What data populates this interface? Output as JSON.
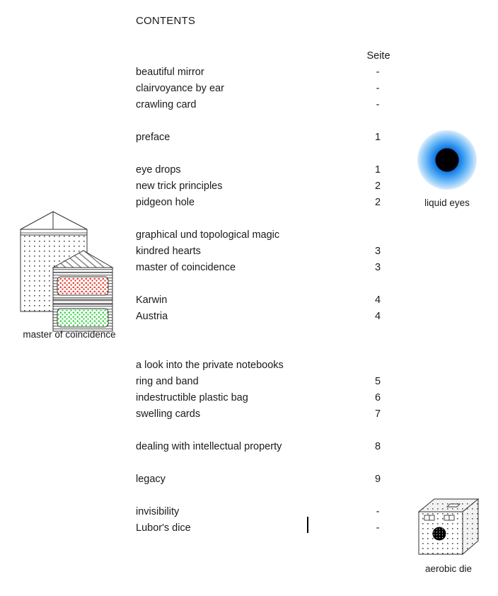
{
  "document": {
    "heading": "CONTENTS",
    "page_column_header": "Seite"
  },
  "toc": {
    "rows": [
      {
        "title": "beautiful mirror",
        "page": "-"
      },
      {
        "title": "clairvoyance by ear",
        "page": "-"
      },
      {
        "title": "crawling card",
        "page": "-"
      },
      {
        "title": "",
        "page": ""
      },
      {
        "title": "preface",
        "page": "1"
      },
      {
        "title": "",
        "page": ""
      },
      {
        "title": "eye drops",
        "page": "1"
      },
      {
        "title": "new trick principles",
        "page": "2"
      },
      {
        "title": "pidgeon hole",
        "page": "2"
      },
      {
        "title": "",
        "page": ""
      },
      {
        "title": "graphical und topological magic",
        "page": ""
      },
      {
        "title": "kindred hearts",
        "page": "3"
      },
      {
        "title": "master of coincidence",
        "page": "3"
      },
      {
        "title": "",
        "page": ""
      },
      {
        "title": "Karwin",
        "page": "4"
      },
      {
        "title": "Austria",
        "page": "4"
      },
      {
        "title": "",
        "page": ""
      },
      {
        "title": "",
        "page": ""
      },
      {
        "title": "a look into the private notebooks",
        "page": ""
      },
      {
        "title": "ring and band",
        "page": "5"
      },
      {
        "title": "indestructible plastic bag",
        "page": "6"
      },
      {
        "title": "swelling cards",
        "page": "7"
      },
      {
        "title": "",
        "page": ""
      },
      {
        "title": "dealing with intellectual property",
        "page": "8"
      },
      {
        "title": "",
        "page": ""
      },
      {
        "title": "legacy",
        "page": "9"
      },
      {
        "title": "",
        "page": ""
      },
      {
        "title": "invisibility",
        "page": "-"
      },
      {
        "title": "Lubor's dice",
        "page": "-"
      }
    ]
  },
  "figures": {
    "master_of_coincidence": {
      "caption": "master of coincidence",
      "colors": {
        "red_fill": "#e03020",
        "green_fill": "#22cc33",
        "outline": "#333333"
      }
    },
    "liquid_eyes": {
      "caption": "liquid eyes",
      "colors": {
        "pupil": "#000000",
        "iris": "#1478e0"
      }
    },
    "aerobic_die": {
      "caption": "aerobic die",
      "colors": {
        "outline": "#333333",
        "pip": "#000000"
      }
    }
  },
  "caret": {
    "visible": "true"
  }
}
